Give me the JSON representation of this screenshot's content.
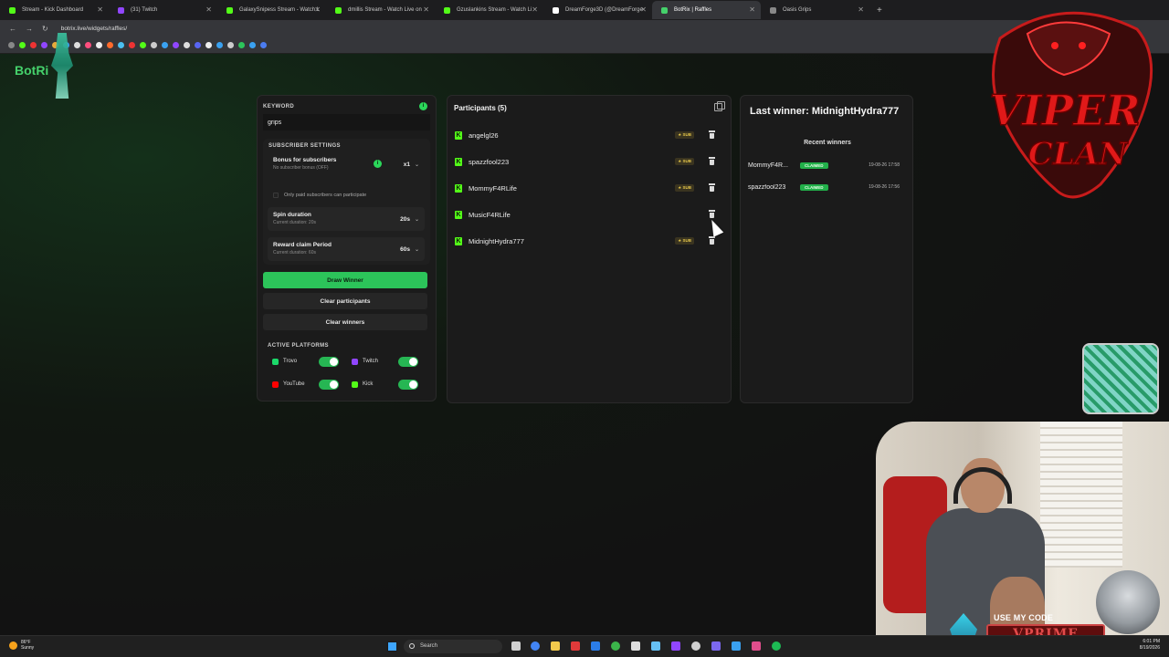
{
  "browser": {
    "tabs": [
      {
        "title": "Stream - Kick Dashboard",
        "color": "#53fc18"
      },
      {
        "title": "(31) Twitch",
        "color": "#9146ff"
      },
      {
        "title": "GalaxySnipess Stream - Watch L",
        "color": "#53fc18"
      },
      {
        "title": "dmillis Stream - Watch Live on",
        "color": "#53fc18"
      },
      {
        "title": "Gzuslankins Stream - Watch Li",
        "color": "#53fc18"
      },
      {
        "title": "DreamForge3D (@DreamForge",
        "color": "#ffffff"
      },
      {
        "title": "BotRix | Raffles",
        "color": "#45d16b",
        "active": true
      },
      {
        "title": "Oasis Grips",
        "color": "#888888"
      }
    ],
    "url": "botrix.live/widgets/raffles/"
  },
  "brand": "BotRi",
  "settings": {
    "keyword_label": "KEYWORD",
    "keyword_value": "grips",
    "subscriber_settings_label": "SUBSCRIBER SETTINGS",
    "bonus": {
      "title": "Bonus for subscribers",
      "sub": "No subscriber bonus (OFF)",
      "value": "x1"
    },
    "only_paid": "Only paid subscribers can participate",
    "spin": {
      "title": "Spin duration",
      "sub": "Current duration: 20s",
      "value": "20s"
    },
    "reward": {
      "title": "Reward claim Period",
      "sub": "Current duration: 60s",
      "value": "60s"
    },
    "draw_button": "Draw Winner",
    "clear_participants_button": "Clear participants",
    "clear_winners_button": "Clear winners",
    "active_platforms_label": "ACTIVE PLATFORMS",
    "platforms": [
      {
        "name": "Trovo",
        "color": "#1bd96a",
        "enabled": true
      },
      {
        "name": "Twitch",
        "color": "#9146ff",
        "enabled": true
      },
      {
        "name": "YouTube",
        "color": "#ff0000",
        "enabled": true
      },
      {
        "name": "Kick",
        "color": "#53fc18",
        "enabled": true
      }
    ]
  },
  "participants": {
    "title": "Participants (5)",
    "sub_label": "SUB",
    "list": [
      {
        "name": "angelgl26",
        "sub": true
      },
      {
        "name": "spazzfool223",
        "sub": true
      },
      {
        "name": "MommyF4RLife",
        "sub": true
      },
      {
        "name": "MusicF4RLife",
        "sub": false
      },
      {
        "name": "MidnightHydra777",
        "sub": true
      }
    ]
  },
  "winners": {
    "last_winner": "Last winner: MidnightHydra777",
    "recent_title": "Recent winners",
    "claimed_label": "CLAIMED",
    "list": [
      {
        "name": "MommyF4R...",
        "date": "19-08-26 17:58"
      },
      {
        "name": "spazzfool223",
        "date": "19-08-26 17:56"
      }
    ]
  },
  "overlay": {
    "clan_line1": "VIPER",
    "clan_line2": "CLAN",
    "use_code": "USE MY CODE",
    "code": "VPRIME"
  },
  "taskbar": {
    "temp": "86°F",
    "weather": "Sunny",
    "search": "Search",
    "time": "6:01 PM",
    "date": "8/19/2026"
  },
  "colors": {
    "accent": "#2cc45a",
    "kick": "#53fc18"
  }
}
